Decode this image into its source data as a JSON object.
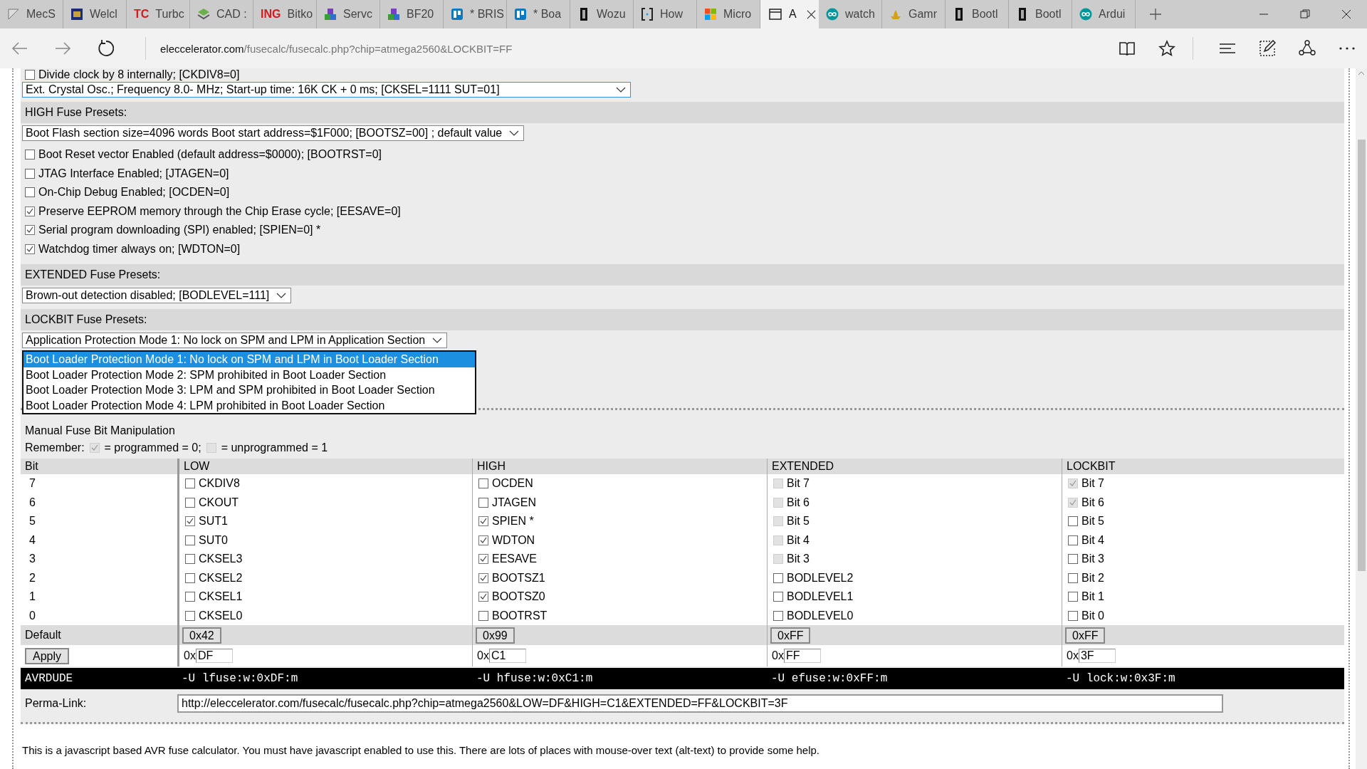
{
  "browser": {
    "tabs": [
      {
        "title": "MecS",
        "selected": false
      },
      {
        "title": "Welcl",
        "selected": false
      },
      {
        "title": "Turbc",
        "logo_text": "TC",
        "selected": false
      },
      {
        "title": "CAD :",
        "selected": false
      },
      {
        "title": "Bitko",
        "logo_text": "ING",
        "selected": false
      },
      {
        "title": "Servc",
        "selected": false
      },
      {
        "title": "BF20",
        "selected": false
      },
      {
        "title": "* BRIS",
        "selected": false
      },
      {
        "title": "* Boa",
        "selected": false
      },
      {
        "title": "Wozu",
        "selected": false
      },
      {
        "title": "How",
        "selected": false
      },
      {
        "title": "Micro",
        "selected": false
      },
      {
        "title": "A",
        "selected": true
      },
      {
        "title": "watch",
        "selected": false
      },
      {
        "title": "Gamr",
        "selected": false
      },
      {
        "title": "Bootl",
        "selected": false
      },
      {
        "title": "Bootl",
        "selected": false
      },
      {
        "title": "Ardui",
        "selected": false
      }
    ],
    "url_host": "eleccelerator.com",
    "url_path": "/fusecalc/fusecalc.php?chip=atmega2560&LOCKBIT=FF"
  },
  "low_presets": {
    "option": {
      "label": "Divide clock by 8 internally; [CKDIV8=0]",
      "checked": false
    },
    "select": "Ext. Crystal Osc.; Frequency 8.0- MHz; Start-up time: 16K CK + 0 ms; [CKSEL=1111 SUT=01]"
  },
  "high_presets": {
    "heading": "HIGH Fuse Presets:",
    "select": "Boot Flash section size=4096 words Boot start address=$1F000; [BOOTSZ=00] ; default value",
    "options": [
      {
        "label": "Boot Reset vector Enabled (default address=$0000); [BOOTRST=0]",
        "checked": false
      },
      {
        "label": "JTAG Interface Enabled; [JTAGEN=0]",
        "checked": false
      },
      {
        "label": "On-Chip Debug Enabled; [OCDEN=0]",
        "checked": false
      },
      {
        "label": "Preserve EEPROM memory through the Chip Erase cycle; [EESAVE=0]",
        "checked": true
      },
      {
        "label": "Serial program downloading (SPI) enabled; [SPIEN=0] *",
        "checked": true
      },
      {
        "label": "Watchdog timer always on; [WDTON=0]",
        "checked": true
      }
    ]
  },
  "extended_presets": {
    "heading": "EXTENDED Fuse Presets:",
    "select": "Brown-out detection disabled; [BODLEVEL=111]"
  },
  "lockbit_presets": {
    "heading": "LOCKBIT Fuse Presets:",
    "select": "Application Protection Mode 1: No lock on SPM and LPM in Application Section",
    "dropdown": [
      {
        "label": "Boot Loader Protection Mode 1: No lock on SPM and LPM in Boot Loader Section",
        "selected": true
      },
      {
        "label": "Boot Loader Protection Mode 2: SPM prohibited in Boot Loader Section",
        "selected": false
      },
      {
        "label": "Boot Loader Protection Mode 3: LPM and SPM prohibited in Boot Loader Section",
        "selected": false
      },
      {
        "label": "Boot Loader Protection Mode 4: LPM prohibited in Boot Loader Section",
        "selected": false
      }
    ]
  },
  "manual": {
    "title": "Manual Fuse Bit Manipulation",
    "remember_label": "Remember:",
    "programmed_label": "= programmed = 0;",
    "unprogrammed_label": "= unprogrammed = 1",
    "columns": [
      "Bit",
      "LOW",
      "HIGH",
      "EXTENDED",
      "LOCKBIT"
    ],
    "rows": [
      {
        "cells": [
          {
            "kind": "bit",
            "text": "7"
          },
          {
            "kind": "checkbox",
            "label": "CKDIV8",
            "checked": false,
            "disabled": false
          },
          {
            "kind": "checkbox",
            "label": "OCDEN",
            "checked": false,
            "disabled": false
          },
          {
            "kind": "checkbox",
            "label": "Bit 7",
            "checked": false,
            "disabled": true
          },
          {
            "kind": "checkbox",
            "label": "Bit 7",
            "checked": true,
            "disabled": true
          }
        ]
      },
      {
        "cells": [
          {
            "kind": "bit",
            "text": "6"
          },
          {
            "kind": "checkbox",
            "label": "CKOUT",
            "checked": false,
            "disabled": false
          },
          {
            "kind": "checkbox",
            "label": "JTAGEN",
            "checked": false,
            "disabled": false
          },
          {
            "kind": "checkbox",
            "label": "Bit 6",
            "checked": false,
            "disabled": true
          },
          {
            "kind": "checkbox",
            "label": "Bit 6",
            "checked": true,
            "disabled": true
          }
        ]
      },
      {
        "cells": [
          {
            "kind": "bit",
            "text": "5"
          },
          {
            "kind": "checkbox",
            "label": "SUT1",
            "checked": true,
            "disabled": false
          },
          {
            "kind": "checkbox",
            "label": "SPIEN *",
            "checked": true,
            "disabled": false
          },
          {
            "kind": "checkbox",
            "label": "Bit 5",
            "checked": false,
            "disabled": true
          },
          {
            "kind": "checkbox",
            "label": "Bit 5",
            "checked": false,
            "disabled": false
          }
        ]
      },
      {
        "cells": [
          {
            "kind": "bit",
            "text": "4"
          },
          {
            "kind": "checkbox",
            "label": "SUT0",
            "checked": false,
            "disabled": false
          },
          {
            "kind": "checkbox",
            "label": "WDTON",
            "checked": true,
            "disabled": false
          },
          {
            "kind": "checkbox",
            "label": "Bit 4",
            "checked": false,
            "disabled": true
          },
          {
            "kind": "checkbox",
            "label": "Bit 4",
            "checked": false,
            "disabled": false
          }
        ]
      },
      {
        "cells": [
          {
            "kind": "bit",
            "text": "3"
          },
          {
            "kind": "checkbox",
            "label": "CKSEL3",
            "checked": false,
            "disabled": false
          },
          {
            "kind": "checkbox",
            "label": "EESAVE",
            "checked": true,
            "disabled": false
          },
          {
            "kind": "checkbox",
            "label": "Bit 3",
            "checked": false,
            "disabled": true
          },
          {
            "kind": "checkbox",
            "label": "Bit 3",
            "checked": false,
            "disabled": false
          }
        ]
      },
      {
        "cells": [
          {
            "kind": "bit",
            "text": "2"
          },
          {
            "kind": "checkbox",
            "label": "CKSEL2",
            "checked": false,
            "disabled": false
          },
          {
            "kind": "checkbox",
            "label": "BOOTSZ1",
            "checked": true,
            "disabled": false
          },
          {
            "kind": "checkbox",
            "label": "BODLEVEL2",
            "checked": false,
            "disabled": false
          },
          {
            "kind": "checkbox",
            "label": "Bit 2",
            "checked": false,
            "disabled": false
          }
        ]
      },
      {
        "cells": [
          {
            "kind": "bit",
            "text": "1"
          },
          {
            "kind": "checkbox",
            "label": "CKSEL1",
            "checked": false,
            "disabled": false
          },
          {
            "kind": "checkbox",
            "label": "BOOTSZ0",
            "checked": true,
            "disabled": false
          },
          {
            "kind": "checkbox",
            "label": "BODLEVEL1",
            "checked": false,
            "disabled": false
          },
          {
            "kind": "checkbox",
            "label": "Bit 1",
            "checked": false,
            "disabled": false
          }
        ]
      },
      {
        "cells": [
          {
            "kind": "bit",
            "text": "0"
          },
          {
            "kind": "checkbox",
            "label": "CKSEL0",
            "checked": false,
            "disabled": false
          },
          {
            "kind": "checkbox",
            "label": "BOOTRST",
            "checked": false,
            "disabled": false
          },
          {
            "kind": "checkbox",
            "label": "BODLEVEL0",
            "checked": false,
            "disabled": false
          },
          {
            "kind": "checkbox",
            "label": "Bit 0",
            "checked": false,
            "disabled": false
          }
        ]
      }
    ],
    "default_label": "Default",
    "defaults": [
      "0x42",
      "0x99",
      "0xFF",
      "0xFF"
    ],
    "apply_label": "Apply",
    "hex_inputs": [
      {
        "prefix": "0x",
        "value": "DF"
      },
      {
        "prefix": "0x",
        "value": "C1"
      },
      {
        "prefix": "0x",
        "value": "FF"
      },
      {
        "prefix": "0x",
        "value": "3F"
      }
    ],
    "avrdude_label": "AVRDUDE",
    "avrdude": [
      "-U lfuse:w:0xDF:m",
      "-U hfuse:w:0xC1:m",
      "-U efuse:w:0xFF:m",
      "-U lock:w:0x3F:m"
    ],
    "permalink_label": "Perma-Link:",
    "permalink": "http://eleccelerator.com/fusecalc/fusecalc.php?chip=atmega2560&LOW=DF&HIGH=C1&EXTENDED=FF&LOCKBIT=3F"
  },
  "footer_text": "This is a javascript based AVR fuse calculator. You must have javascript enabled to use this. There are lots of places with mouse-over text (alt-text) to provide some help."
}
